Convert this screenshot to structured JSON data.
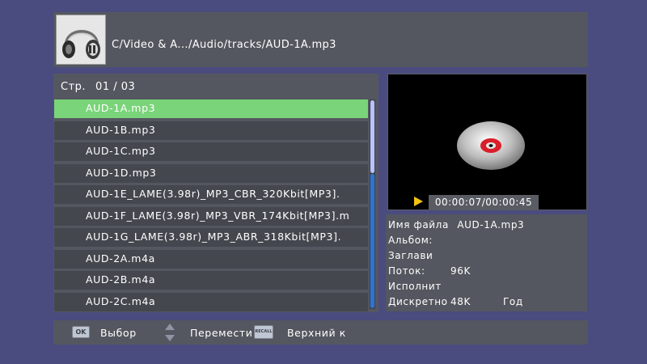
{
  "header": {
    "path": "C/Video & A.../Audio/tracks/AUD-1A.mp3",
    "icon": "headphones-icon"
  },
  "list": {
    "page_prefix": "Стр.",
    "page_value": "01 / 03",
    "items": [
      {
        "label": "AUD-1A.mp3",
        "selected": true
      },
      {
        "label": "AUD-1B.mp3",
        "selected": false
      },
      {
        "label": "AUD-1C.mp3",
        "selected": false
      },
      {
        "label": "AUD-1D.mp3",
        "selected": false
      },
      {
        "label": "AUD-1E_LAME(3.98r)_MP3_CBR_320Kbit[MP3].",
        "selected": false
      },
      {
        "label": "AUD-1F_LAME(3.98r)_MP3_VBR_174Kbit[MP3].m",
        "selected": false
      },
      {
        "label": "AUD-1G_LAME(3.98r)_MP3_ABR_318Kbit[MP3].",
        "selected": false
      },
      {
        "label": "AUD-2A.m4a",
        "selected": false
      },
      {
        "label": "AUD-2B.m4a",
        "selected": false
      },
      {
        "label": "AUD-2C.m4a",
        "selected": false
      }
    ]
  },
  "preview": {
    "time": "00:00:07/00:00:45",
    "icons": [
      "disc-icon",
      "play-icon"
    ]
  },
  "info": {
    "filename_label": "Имя файла",
    "filename_value": "AUD-1A.mp3",
    "album_label": "Альбом:",
    "title_label": "Заглави",
    "stream_label": "Поток:",
    "stream_value": "96K",
    "artist_label": "Исполнит",
    "sample_label": "Дискретно",
    "sample_value": "48K",
    "year_label": "Год"
  },
  "footer": {
    "ok_key": "OK",
    "ok_label": "Выбор",
    "move_label": "Перемести",
    "recall_key": "RECALL",
    "recall_label": "Верхний к"
  },
  "colors": {
    "background": "#4a4b7e",
    "panel": "#54575f",
    "row": "#44474e",
    "selected_row": "#7ad47a",
    "scroll_thumb": "#b9c1ff",
    "scroll_track": "#2c74d8",
    "play": "#f1c40f"
  }
}
